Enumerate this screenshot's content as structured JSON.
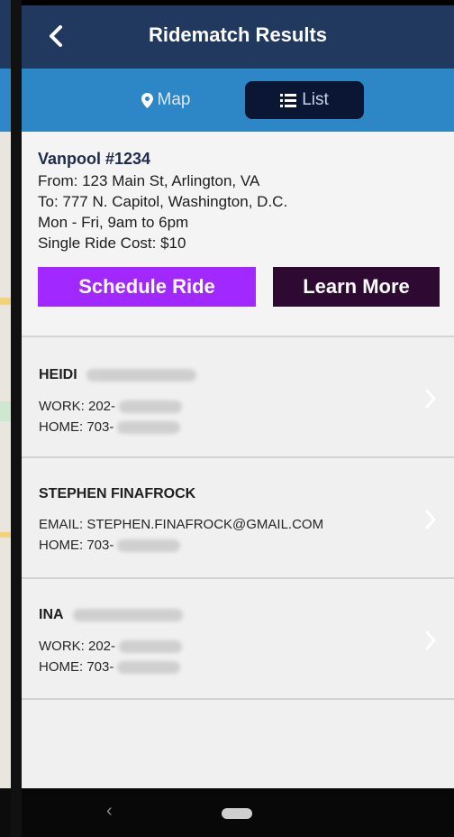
{
  "header": {
    "title": "Ridematch Results",
    "back_icon": "chevron-left-icon"
  },
  "tabs": [
    {
      "label": "Map",
      "icon": "map-marker-icon",
      "active": false
    },
    {
      "label": "List",
      "icon": "list-icon",
      "active": true
    }
  ],
  "vanpool": {
    "title": "Vanpool #1234",
    "from": "From: 123 Main St, Arlington, VA",
    "to": "To: 777 N. Capitol, Washington, D.C.",
    "schedule": "Mon - Fri, 9am to 6pm",
    "cost": "Single Ride Cost: $10",
    "schedule_button": "Schedule Ride",
    "learn_button": "Learn More"
  },
  "contacts": [
    {
      "name": "HEIDI",
      "line1": "WORK: 202-",
      "line2": "HOME: 703-"
    },
    {
      "name": "STEPHEN FINAFROCK",
      "line1": "EMAIL: STEPHEN.FINAFROCK@GMAIL.COM",
      "line2": "HOME: 703-"
    },
    {
      "name": "INA",
      "line1": "WORK: 202-",
      "line2": "HOME: 703-"
    }
  ],
  "colors": {
    "header": "#21385f",
    "tabbar": "#2d86c6",
    "active_tab": "#0a1633",
    "schedule_button": "#a128ff",
    "learn_button": "#2e0a33"
  },
  "navbar": {
    "back_icon": "nav-back-icon",
    "home_icon": "nav-home-pill-icon"
  }
}
